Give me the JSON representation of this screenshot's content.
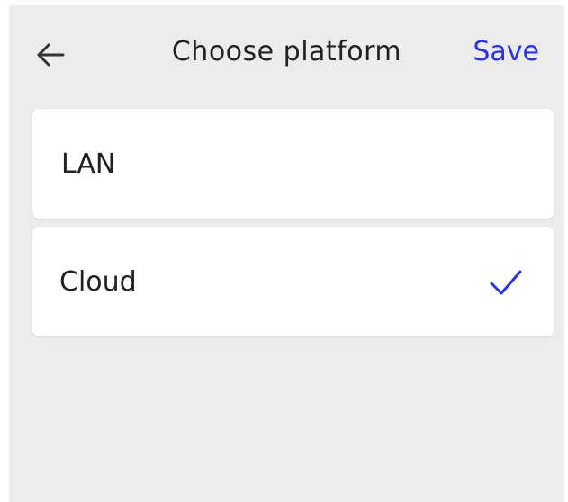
{
  "header": {
    "title": "Choose platform",
    "save_label": "Save",
    "back_icon": "arrow-left-icon"
  },
  "options": [
    {
      "label": "LAN",
      "selected": false
    },
    {
      "label": "Cloud",
      "selected": true,
      "check_icon": "checkmark-icon"
    }
  ],
  "colors": {
    "accent": "#2a35e0",
    "background": "#ececec",
    "card": "#ffffff",
    "text": "#222222"
  }
}
